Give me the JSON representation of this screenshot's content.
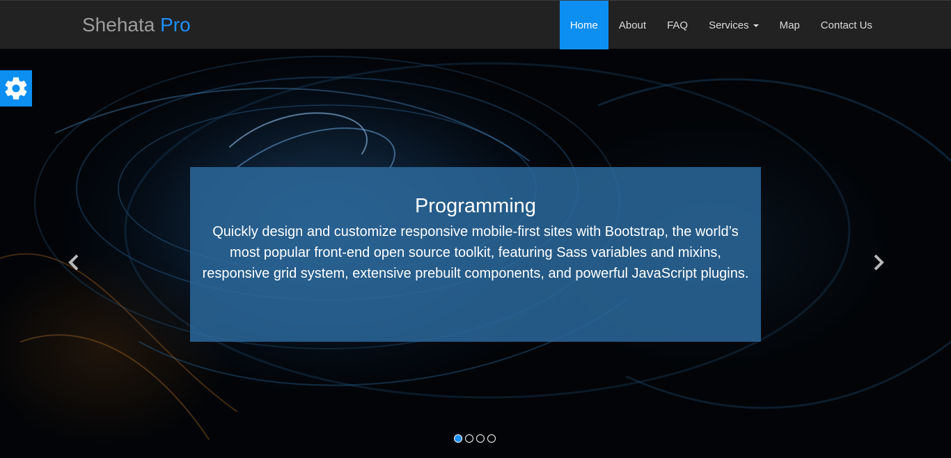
{
  "brand": {
    "name": "Shehata",
    "accent": "Pro"
  },
  "nav": {
    "items": [
      {
        "label": "Home",
        "active": true
      },
      {
        "label": "About"
      },
      {
        "label": "FAQ"
      },
      {
        "label": "Services",
        "dropdown": true
      },
      {
        "label": "Map"
      },
      {
        "label": "Contact Us"
      }
    ]
  },
  "carousel": {
    "slide_title": "Programming",
    "slide_text": "Quickly design and customize responsive mobile-first sites with Bootstrap, the world’s most popular front-end open source toolkit, featuring Sass variables and mixins, responsive grid system, extensive prebuilt components, and powerful JavaScript plugins.",
    "slide_count": 4,
    "active_index": 0,
    "prev_icon": "chevron-left-icon",
    "next_icon": "chevron-right-icon"
  },
  "settings": {
    "icon": "gear-icon"
  },
  "colors": {
    "accent": "#1e90ff",
    "nav_active": "#0d8ff2",
    "navbar_bg": "#222222",
    "caption_bg": "#2c699b"
  }
}
